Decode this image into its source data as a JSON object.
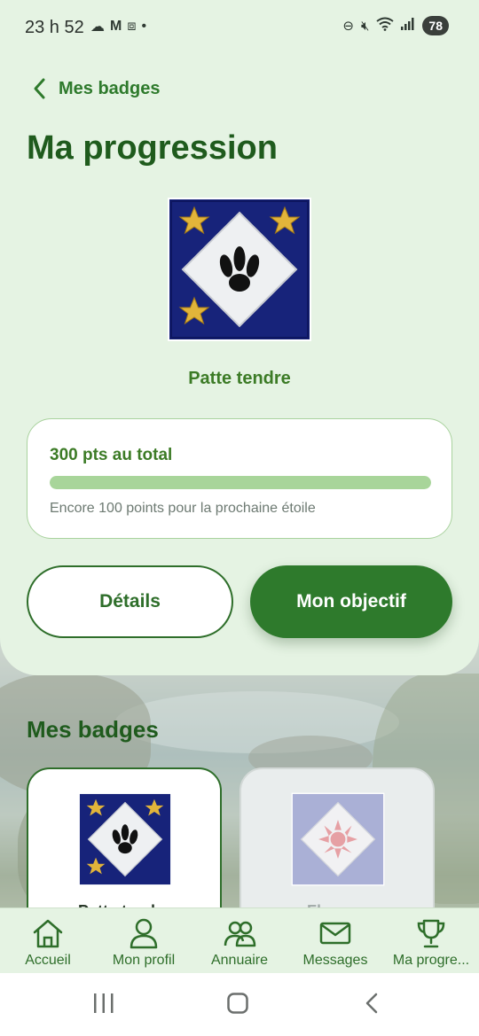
{
  "status_bar": {
    "time": "23 h 52",
    "left_icons": [
      "cloud-icon",
      "gmail-icon",
      "screenshot-icon",
      "dot-icon"
    ],
    "right_icons": [
      "do-not-disturb-icon",
      "mute-icon",
      "wifi-icon",
      "signal-icon"
    ],
    "battery": "78"
  },
  "header": {
    "back_label": "Mes badges",
    "title": "Ma progression"
  },
  "current_badge": {
    "name": "Patte tendre"
  },
  "points_card": {
    "total": "300 pts au total",
    "progress_fraction": 1.0,
    "hint": "Encore 100 points pour la prochaine étoile"
  },
  "actions": {
    "details_label": "Détails",
    "goal_label": "Mon objectif"
  },
  "badges_section": {
    "title": "Mes badges",
    "items": [
      {
        "label": "Patte tendre",
        "state": "active"
      },
      {
        "label": "Flamme",
        "state": "locked"
      }
    ]
  },
  "bottom_nav": {
    "items": [
      {
        "label": "Accueil",
        "icon": "home-icon"
      },
      {
        "label": "Mon profil",
        "icon": "user-icon"
      },
      {
        "label": "Annuaire",
        "icon": "users-icon"
      },
      {
        "label": "Messages",
        "icon": "mail-icon"
      },
      {
        "label": "Ma progre...",
        "icon": "trophy-icon"
      }
    ]
  },
  "colors": {
    "brand_green": "#2e7a2c",
    "dark_green": "#1f5b1d",
    "panel_bg": "#e5f3e3",
    "progress_fill": "#a8d59a"
  }
}
